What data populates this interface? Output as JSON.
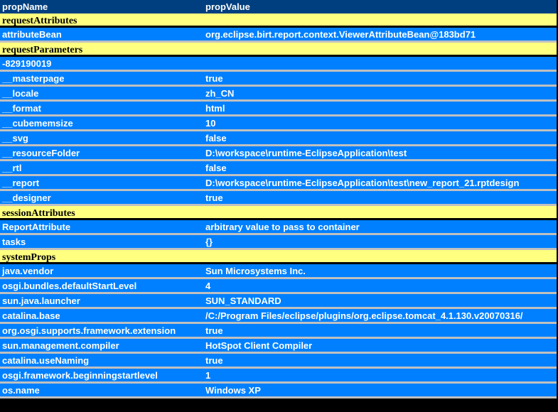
{
  "header": {
    "name": "propName",
    "value": "propValue"
  },
  "sections": [
    {
      "title": "requestAttributes",
      "rows": [
        [
          "attributeBean",
          "org.eclipse.birt.report.context.ViewerAttributeBean@183bd71"
        ]
      ]
    },
    {
      "title": "requestParameters",
      "rows": [
        [
          "-829190019",
          ""
        ],
        [
          "__masterpage",
          "true"
        ],
        [
          "__locale",
          "zh_CN"
        ],
        [
          "__format",
          "html"
        ],
        [
          "__cubememsize",
          "10"
        ],
        [
          "__svg",
          "false"
        ],
        [
          "__resourceFolder",
          "D:\\workspace\\runtime-EclipseApplication\\test"
        ],
        [
          "__rtl",
          "false"
        ],
        [
          "__report",
          "D:\\workspace\\runtime-EclipseApplication\\test\\new_report_21.rptdesign"
        ],
        [
          "__designer",
          "true"
        ]
      ]
    },
    {
      "title": "sessionAttributes",
      "rows": [
        [
          "ReportAttribute",
          "arbitrary value to pass to container"
        ],
        [
          "tasks",
          "{}"
        ]
      ]
    },
    {
      "title": "systemProps",
      "rows": [
        [
          "java.vendor",
          "Sun Microsystems Inc."
        ],
        [
          "osgi.bundles.defaultStartLevel",
          "4"
        ],
        [
          "sun.java.launcher",
          "SUN_STANDARD"
        ],
        [
          "catalina.base",
          "/C:/Program Files/eclipse/plugins/org.eclipse.tomcat_4.1.130.v20070316/"
        ],
        [
          "org.osgi.supports.framework.extension",
          "true"
        ],
        [
          "sun.management.compiler",
          "HotSpot Client Compiler"
        ],
        [
          "catalina.useNaming",
          "true"
        ],
        [
          "osgi.framework.beginningstartlevel",
          "1"
        ],
        [
          "os.name",
          "Windows XP"
        ]
      ]
    }
  ]
}
